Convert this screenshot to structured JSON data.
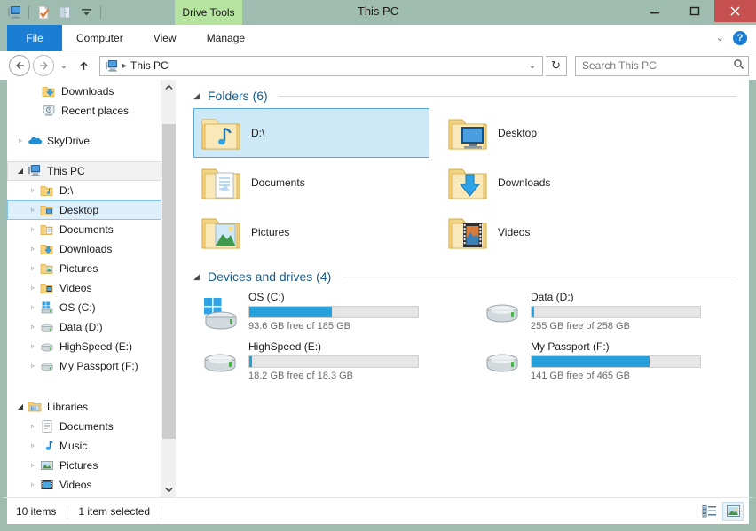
{
  "window": {
    "title": "This PC",
    "contextual_tab": "Drive Tools",
    "controls": {
      "minimize": "—",
      "maximize": "❐",
      "close": "✕"
    },
    "quick_access": [
      {
        "name": "this-pc-icon",
        "label": "This PC"
      },
      {
        "name": "properties-icon",
        "label": "Properties"
      },
      {
        "name": "new-folder-icon",
        "label": "New folder"
      },
      {
        "name": "customize-qat-icon",
        "label": "Customize Quick Access Toolbar"
      }
    ]
  },
  "ribbon": {
    "tabs": [
      {
        "label": "File",
        "active": true
      },
      {
        "label": "Computer",
        "active": false
      },
      {
        "label": "View",
        "active": false
      },
      {
        "label": "Manage",
        "active": false
      }
    ],
    "minimize_ribbon": "⌄",
    "help": "?"
  },
  "address": {
    "back": "←",
    "forward": "→",
    "recent": "⌄",
    "up": "↑",
    "breadcrumb_icon": "computer-icon",
    "breadcrumb": "This PC",
    "crumb_sep": "▸",
    "crumb_dropdown": "⌄",
    "refresh": "↻",
    "search_placeholder": "Search This PC",
    "search_value": "",
    "search_icon": "⌕"
  },
  "sidebar": {
    "items": [
      {
        "label": "Downloads",
        "icon": "downloads-folder-icon",
        "indent": 1,
        "expander": "",
        "state": "none"
      },
      {
        "label": "Recent places",
        "icon": "recent-places-icon",
        "indent": 1,
        "expander": "",
        "state": "none"
      },
      {
        "label": "SkyDrive",
        "icon": "skydrive-icon",
        "indent": 0,
        "expander": "▹",
        "state": "none"
      },
      {
        "label": "This PC",
        "icon": "computer-icon",
        "indent": 0,
        "expander": "◢",
        "state": "hover"
      },
      {
        "label": "D:\\",
        "icon": "music-folder-icon",
        "indent": 1,
        "expander": "▹",
        "state": "none"
      },
      {
        "label": "Desktop",
        "icon": "desktop-folder-icon",
        "indent": 1,
        "expander": "▹",
        "state": "selected"
      },
      {
        "label": "Documents",
        "icon": "documents-folder-icon",
        "indent": 1,
        "expander": "▹",
        "state": "none"
      },
      {
        "label": "Downloads",
        "icon": "downloads-folder-icon",
        "indent": 1,
        "expander": "▹",
        "state": "none"
      },
      {
        "label": "Pictures",
        "icon": "pictures-folder-icon",
        "indent": 1,
        "expander": "▹",
        "state": "none"
      },
      {
        "label": "Videos",
        "icon": "videos-folder-icon",
        "indent": 1,
        "expander": "▹",
        "state": "none"
      },
      {
        "label": "OS (C:)",
        "icon": "windows-drive-icon",
        "indent": 1,
        "expander": "▹",
        "state": "none"
      },
      {
        "label": "Data (D:)",
        "icon": "drive-icon",
        "indent": 1,
        "expander": "▹",
        "state": "none"
      },
      {
        "label": "HighSpeed (E:)",
        "icon": "drive-icon",
        "indent": 1,
        "expander": "▹",
        "state": "none"
      },
      {
        "label": "My Passport (F:)",
        "icon": "drive-icon",
        "indent": 1,
        "expander": "▹",
        "state": "none"
      },
      {
        "label": "Libraries",
        "icon": "libraries-icon",
        "indent": 0,
        "expander": "◢",
        "state": "none"
      },
      {
        "label": "Documents",
        "icon": "documents-library-icon",
        "indent": 1,
        "expander": "▹",
        "state": "none"
      },
      {
        "label": "Music",
        "icon": "music-library-icon",
        "indent": 1,
        "expander": "▹",
        "state": "none"
      },
      {
        "label": "Pictures",
        "icon": "pictures-library-icon",
        "indent": 1,
        "expander": "▹",
        "state": "none"
      },
      {
        "label": "Videos",
        "icon": "videos-library-icon",
        "indent": 1,
        "expander": "▹",
        "state": "none"
      }
    ],
    "scroll_up": "▲",
    "scroll_down": "▼"
  },
  "main": {
    "folders_group": {
      "title": "Folders (6)",
      "collapse": "◢",
      "items": [
        {
          "label": "D:\\",
          "icon": "music-folder-icon",
          "selected": true
        },
        {
          "label": "Desktop",
          "icon": "desktop-folder-icon",
          "selected": false
        },
        {
          "label": "Documents",
          "icon": "documents-folder-icon",
          "selected": false
        },
        {
          "label": "Downloads",
          "icon": "downloads-folder-icon",
          "selected": false
        },
        {
          "label": "Pictures",
          "icon": "pictures-folder-icon",
          "selected": false
        },
        {
          "label": "Videos",
          "icon": "videos-folder-icon",
          "selected": false
        }
      ]
    },
    "drives_group": {
      "title": "Devices and drives (4)",
      "collapse": "◢",
      "items": [
        {
          "label": "OS (C:)",
          "icon": "windows-drive-icon",
          "free_text": "93.6 GB free of 185 GB",
          "used_percent": 49,
          "bar_color": "#26a0da"
        },
        {
          "label": "Data (D:)",
          "icon": "drive-icon",
          "free_text": "255 GB free of 258 GB",
          "used_percent": 1,
          "bar_color": "#26a0da"
        },
        {
          "label": "HighSpeed (E:)",
          "icon": "drive-icon",
          "free_text": "18.2 GB free of 18.3 GB",
          "used_percent": 1,
          "bar_color": "#26a0da"
        },
        {
          "label": "My Passport (F:)",
          "icon": "drive-icon",
          "free_text": "141 GB free of 465 GB",
          "used_percent": 70,
          "bar_color": "#26a0da"
        }
      ]
    }
  },
  "status": {
    "item_count": "10 items",
    "selection": "1 item selected",
    "views": [
      {
        "name": "details-view-button",
        "active": false
      },
      {
        "name": "large-icons-view-button",
        "active": true
      }
    ]
  },
  "colors": {
    "titlebar": "#9fbcb0",
    "contextual_tab": "#b6e3a0",
    "file_tab": "#1a7fd4",
    "close_button": "#c75050",
    "selection_blue": "#cde8f7",
    "selection_border": "#5aabdc",
    "progress_blue": "#26a0da",
    "group_header_text": "#1b5c8a"
  }
}
